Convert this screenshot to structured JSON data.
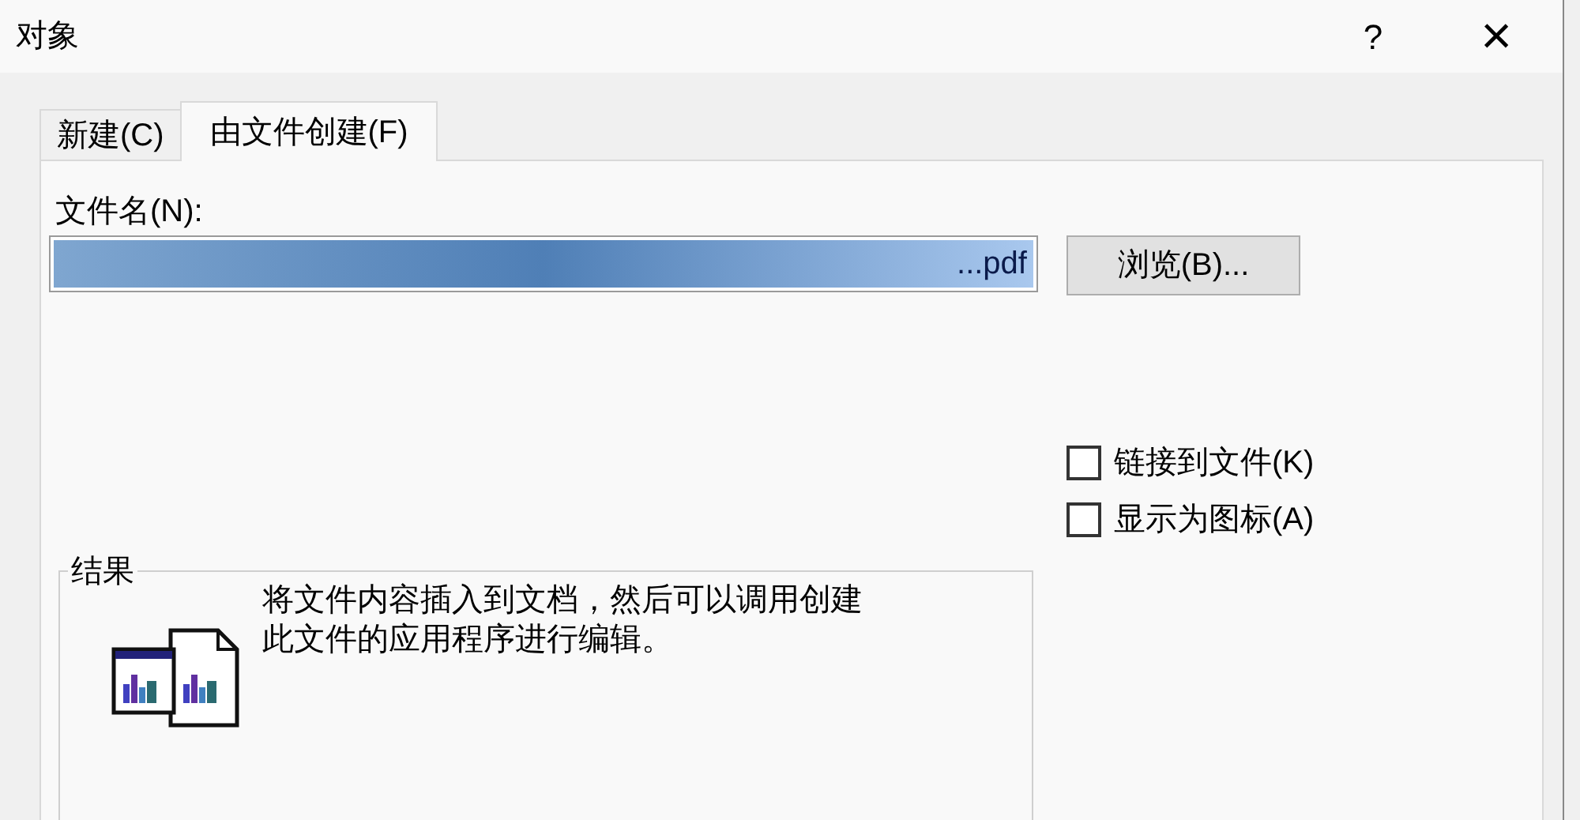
{
  "window": {
    "title": "对象",
    "help": "?",
    "close": "×"
  },
  "tabs": [
    {
      "label": "新建(C)",
      "selected": false
    },
    {
      "label": "由文件创建(F)",
      "selected": true
    }
  ],
  "file_name": {
    "label": "文件名(N):",
    "value": "...pdf",
    "text_selected": true
  },
  "browse_button": "浏览(B)...",
  "options": [
    {
      "label": "链接到文件(K)",
      "checked": false
    },
    {
      "label": "显示为图标(A)",
      "checked": false
    }
  ],
  "result": {
    "title": "结果",
    "description": "将文件内容插入到文档，然后可以调用创建此文件的应用程序进行编辑。"
  }
}
